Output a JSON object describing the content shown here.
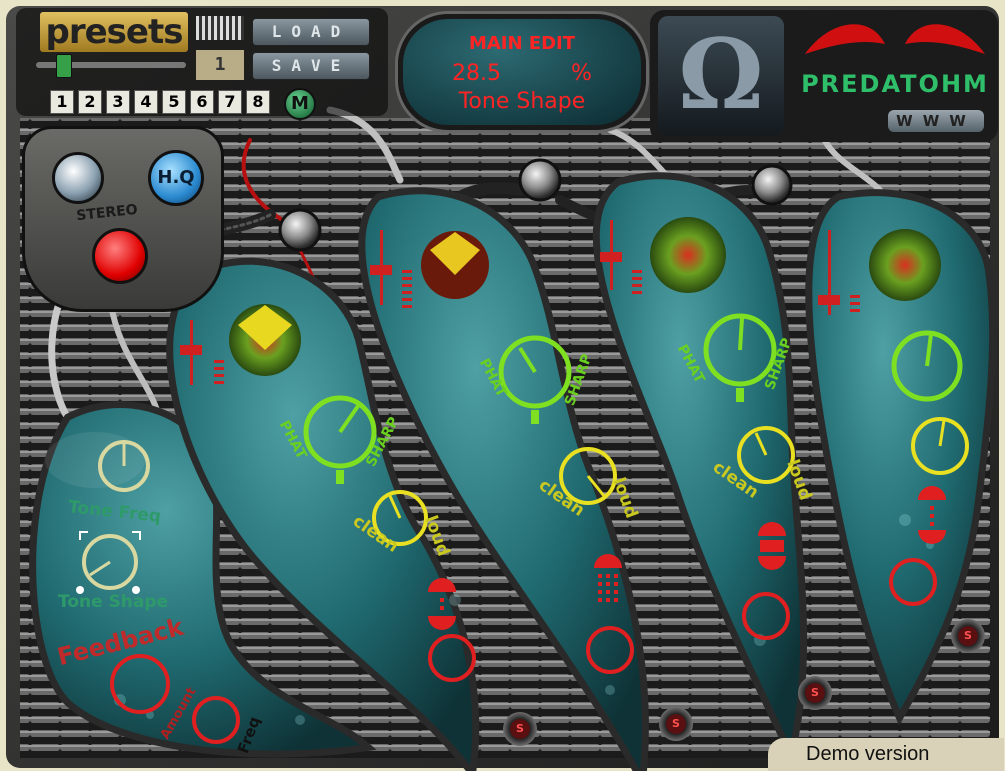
{
  "presets": {
    "title": "presets",
    "load_label": "LOAD",
    "save_label": "SAVE",
    "current_program": "1",
    "slots": [
      "1",
      "2",
      "3",
      "4",
      "5",
      "6",
      "7",
      "8"
    ],
    "m_label": "M"
  },
  "display": {
    "title": "MAIN EDIT",
    "value": "28.5",
    "unit": "%",
    "parameter": "Tone Shape"
  },
  "brand": {
    "logo_symbol": "Ω",
    "name": "PREDATOHM",
    "www_label": "WWW"
  },
  "mode_panel": {
    "stereo_label": "STEREO",
    "hq_label": "H.Q"
  },
  "feedback_section": {
    "tone_freq_label": "Tone Freq",
    "tone_shape_label": "Tone Shape",
    "title": "Feedback",
    "amount_label": "Amount",
    "freq_label": "Freq"
  },
  "bands": [
    {
      "phat_label": "PHAT",
      "sharp_label": "SHARP",
      "clean_label": "clean",
      "loud_label": "loud",
      "solo_label": "S"
    },
    {
      "phat_label": "PHAT",
      "sharp_label": "SHARP",
      "clean_label": "clean",
      "loud_label": "loud",
      "solo_label": "S"
    },
    {
      "phat_label": "PHAT",
      "sharp_label": "SHARP",
      "clean_label": "clean",
      "loud_label": "loud",
      "solo_label": "S"
    },
    {
      "solo_label": "S"
    }
  ],
  "footer": {
    "demo_label": "Demo version"
  },
  "colors": {
    "display_text": "#ff2424",
    "knob_green": "#7ee020",
    "knob_yellow": "#e8e020",
    "knob_red": "#e02020",
    "knob_pale": "#d8d8a0",
    "brand_green": "#2fbf6a",
    "pod_teal": "#2e7f86"
  }
}
